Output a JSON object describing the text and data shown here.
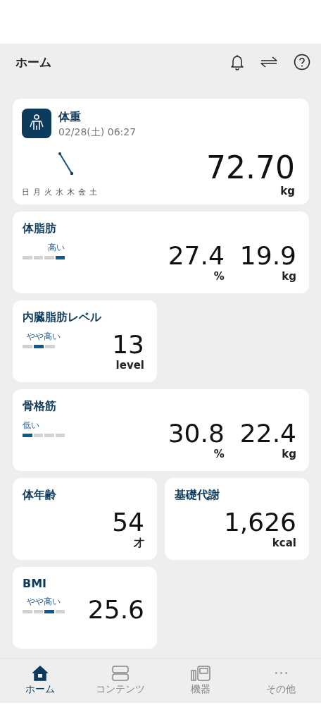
{
  "header": {
    "title": "ホーム"
  },
  "cards": [
    {
      "kind": "weight",
      "title": "体重",
      "date": "02/28(土) 06:27",
      "days": [
        "日",
        "月",
        "火",
        "水",
        "木",
        "金",
        "土"
      ],
      "values": [
        {
          "value": "72.70",
          "unit": "kg"
        }
      ]
    },
    {
      "kind": "wide",
      "title": "体脂肪",
      "rating": "高い",
      "segments": [
        {
          "selected": false
        },
        {
          "selected": false
        },
        {
          "selected": false
        },
        {
          "selected": true
        }
      ],
      "values": [
        {
          "value": "27.4",
          "unit": "%"
        },
        {
          "value": "19.9",
          "unit": "kg"
        }
      ]
    },
    {
      "kind": "half",
      "title": "内臓脂肪レベル",
      "rating": "やや高い",
      "segments": [
        {
          "selected": false
        },
        {
          "selected": true
        },
        {
          "selected": false
        }
      ],
      "values": [
        {
          "value": "13",
          "unit": "level"
        }
      ]
    },
    {
      "kind": "wide",
      "title": "骨格筋",
      "rating": "低い",
      "segments": [
        {
          "selected": true
        },
        {
          "selected": false
        },
        {
          "selected": false
        },
        {
          "selected": false
        }
      ],
      "values": [
        {
          "value": "30.8",
          "unit": "%"
        },
        {
          "value": "22.4",
          "unit": "kg"
        }
      ]
    },
    {
      "kind": "half",
      "title": "体年齢",
      "values": [
        {
          "value": "54",
          "unit": "才"
        }
      ]
    },
    {
      "kind": "half",
      "title": "基礎代謝",
      "values": [
        {
          "value": "1,626",
          "unit": "kcal"
        }
      ]
    },
    {
      "kind": "half",
      "title": "BMI",
      "rating": "やや高い",
      "segments": [
        {
          "selected": false
        },
        {
          "selected": false
        },
        {
          "selected": true
        },
        {
          "selected": false
        }
      ],
      "values": [
        {
          "value": "25.6"
        }
      ]
    }
  ],
  "nav": [
    {
      "kind": "home",
      "label": "ホーム",
      "selected": true
    },
    {
      "kind": "contents",
      "label": "コンテンツ",
      "selected": false
    },
    {
      "kind": "devices",
      "label": "機器",
      "selected": false
    },
    {
      "kind": "more",
      "label": "その他",
      "selected": false
    }
  ]
}
